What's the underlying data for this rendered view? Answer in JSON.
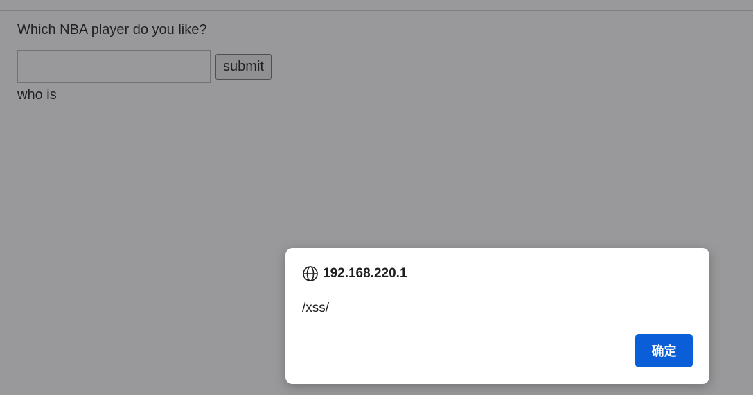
{
  "page": {
    "question": "Which NBA player do you like?",
    "input_value": "",
    "submit_label": "submit",
    "result_prefix": "who is"
  },
  "dialog": {
    "icon": "globe-icon",
    "origin": "192.168.220.1",
    "message": "/xss/",
    "ok_label": "确定",
    "ok_color": "#0a5fd8"
  },
  "overlay_color": "#202124"
}
